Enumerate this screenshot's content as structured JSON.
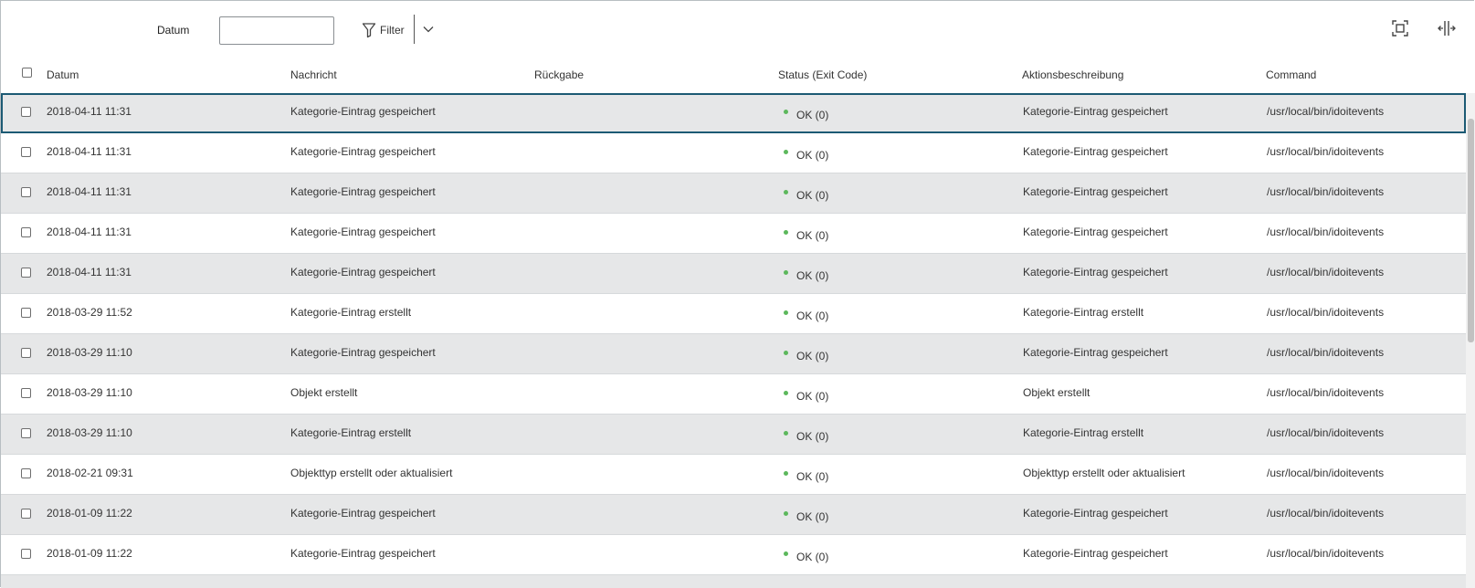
{
  "toolbar": {
    "date_label": "Datum",
    "date_value": "",
    "filter_label": "Filter",
    "filter_icon": "filter-icon",
    "dropdown_icon": "chevron-down-icon",
    "fullscreen_icon": "fullscreen-icon",
    "columns_icon": "column-resize-icon"
  },
  "table": {
    "columns": [
      "Datum",
      "Nachricht",
      "Rückgabe",
      "Status (Exit Code)",
      "Aktionsbeschreibung",
      "Command"
    ],
    "rows": [
      {
        "date": "2018-04-11 11:31",
        "message": "Kategorie-Eintrag gespeichert",
        "return": "",
        "status": "OK (0)",
        "action": "Kategorie-Eintrag gespeichert",
        "command": "/usr/local/bin/idoitevents"
      },
      {
        "date": "2018-04-11 11:31",
        "message": "Kategorie-Eintrag gespeichert",
        "return": "",
        "status": "OK (0)",
        "action": "Kategorie-Eintrag gespeichert",
        "command": "/usr/local/bin/idoitevents"
      },
      {
        "date": "2018-04-11 11:31",
        "message": "Kategorie-Eintrag gespeichert",
        "return": "",
        "status": "OK (0)",
        "action": "Kategorie-Eintrag gespeichert",
        "command": "/usr/local/bin/idoitevents"
      },
      {
        "date": "2018-04-11 11:31",
        "message": "Kategorie-Eintrag gespeichert",
        "return": "",
        "status": "OK (0)",
        "action": "Kategorie-Eintrag gespeichert",
        "command": "/usr/local/bin/idoitevents"
      },
      {
        "date": "2018-04-11 11:31",
        "message": "Kategorie-Eintrag gespeichert",
        "return": "",
        "status": "OK (0)",
        "action": "Kategorie-Eintrag gespeichert",
        "command": "/usr/local/bin/idoitevents"
      },
      {
        "date": "2018-03-29 11:52",
        "message": "Kategorie-Eintrag erstellt",
        "return": "",
        "status": "OK (0)",
        "action": "Kategorie-Eintrag erstellt",
        "command": "/usr/local/bin/idoitevents"
      },
      {
        "date": "2018-03-29 11:10",
        "message": "Kategorie-Eintrag gespeichert",
        "return": "",
        "status": "OK (0)",
        "action": "Kategorie-Eintrag gespeichert",
        "command": "/usr/local/bin/idoitevents"
      },
      {
        "date": "2018-03-29 11:10",
        "message": "Objekt erstellt",
        "return": "",
        "status": "OK (0)",
        "action": "Objekt erstellt",
        "command": "/usr/local/bin/idoitevents"
      },
      {
        "date": "2018-03-29 11:10",
        "message": "Kategorie-Eintrag erstellt",
        "return": "",
        "status": "OK (0)",
        "action": "Kategorie-Eintrag erstellt",
        "command": "/usr/local/bin/idoitevents"
      },
      {
        "date": "2018-02-21 09:31",
        "message": "Objekttyp erstellt oder aktualisiert",
        "return": "",
        "status": "OK (0)",
        "action": "Objekttyp erstellt oder aktualisiert",
        "command": "/usr/local/bin/idoitevents"
      },
      {
        "date": "2018-01-09 11:22",
        "message": "Kategorie-Eintrag gespeichert",
        "return": "",
        "status": "OK (0)",
        "action": "Kategorie-Eintrag gespeichert",
        "command": "/usr/local/bin/idoitevents"
      },
      {
        "date": "2018-01-09 11:22",
        "message": "Kategorie-Eintrag gespeichert",
        "return": "",
        "status": "OK (0)",
        "action": "Kategorie-Eintrag gespeichert",
        "command": "/usr/local/bin/idoitevents"
      }
    ]
  },
  "colors": {
    "status_ok": "#5cb85c",
    "row_alt": "#e6e7e8",
    "selection_border": "#1c5a74"
  }
}
